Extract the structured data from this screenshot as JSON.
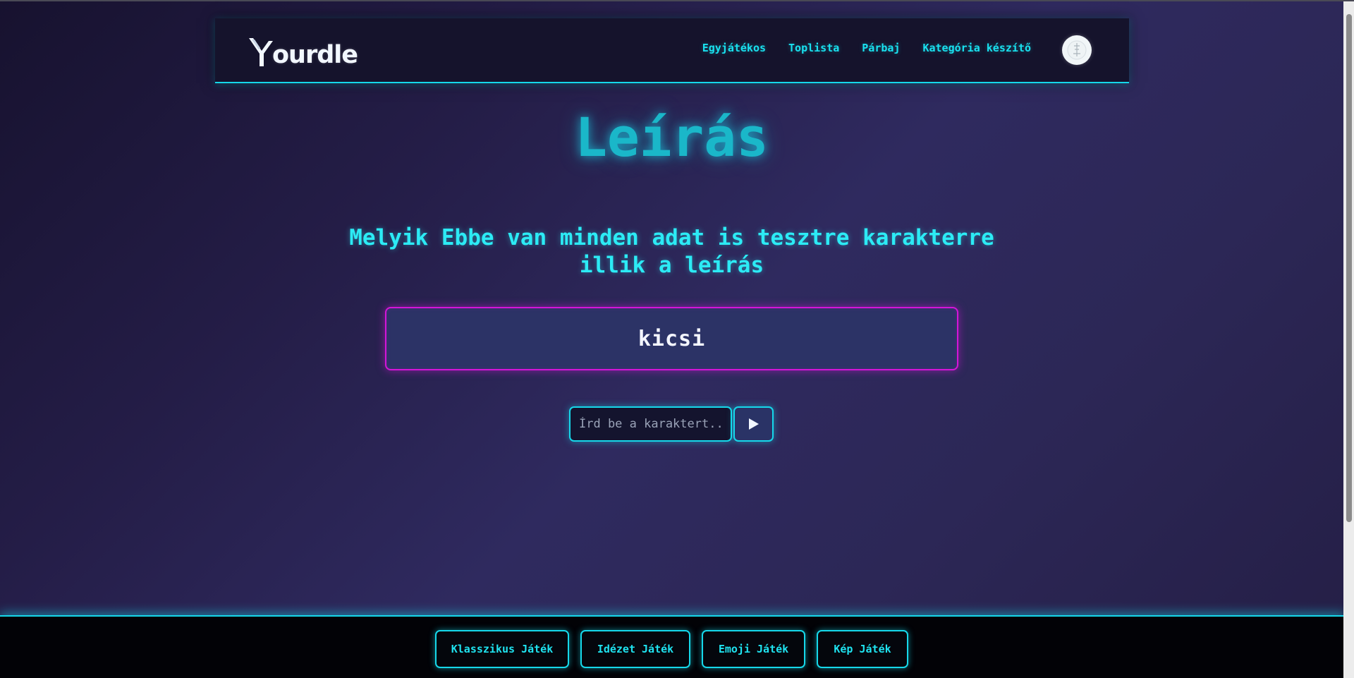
{
  "header": {
    "logo_text": "ourdle",
    "nav": [
      {
        "label": "Egyjátékos"
      },
      {
        "label": "Toplista"
      },
      {
        "label": "Párbaj"
      },
      {
        "label": "Kategória készítő"
      }
    ]
  },
  "main": {
    "title": "Leírás",
    "question": "Melyik Ebbe van minden adat is tesztre karakterre illik a leírás",
    "clue": "kicsi",
    "input_placeholder": "Írd be a karaktert...",
    "input_value": ""
  },
  "footer": {
    "buttons": [
      {
        "label": "Klasszikus Játék"
      },
      {
        "label": "Idézet Játék"
      },
      {
        "label": "Emoji Játék"
      },
      {
        "label": "Kép Játék"
      }
    ]
  },
  "colors": {
    "accent_cyan": "#16d8ea",
    "accent_magenta": "#d415d8",
    "header_bg": "#15132c",
    "footer_bg": "#020206"
  },
  "icons": {
    "logo": "y-logo-icon",
    "avatar": "avatar-icon",
    "submit": "play-icon"
  }
}
